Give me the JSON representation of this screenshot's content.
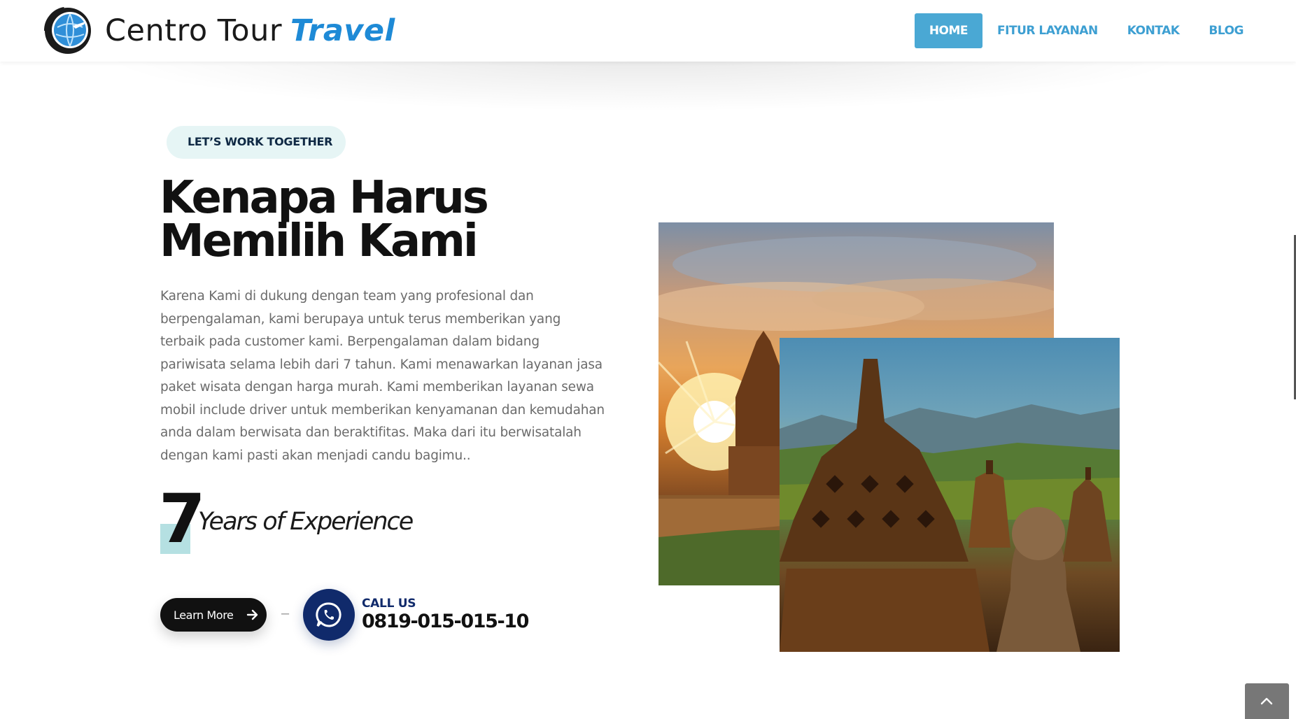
{
  "header": {
    "logo_text_primary": "Centro Tour",
    "logo_text_accent": "Travel",
    "nav": [
      {
        "label": "HOME",
        "active": true
      },
      {
        "label": "FITUR LAYANAN",
        "active": false
      },
      {
        "label": "KONTAK",
        "active": false
      },
      {
        "label": "BLOG",
        "active": false
      }
    ]
  },
  "section": {
    "tag": "LET’S WORK TOGETHER",
    "title": "Kenapa Harus Memilih Kami",
    "description": "Karena Kami di dukung dengan team yang profesional dan berpengalaman, kami berupaya untuk terus memberikan yang terbaik pada customer kami. Berpengalaman dalam bidang pariwisata selama lebih dari 7 tahun. Kami menawarkan layanan jasa paket wisata dengan harga murah. Kami memberikan layanan sewa mobil include driver untuk memberikan kenyamanan dan kemudahan anda dalam berwisata dan beraktifitas. Maka dari itu berwisatalah dengan kami pasti akan menjadi candu bagimu..",
    "experience_number": "7",
    "experience_text": "Years of Experience",
    "learn_more_label": "Learn More",
    "separator": "–",
    "call_label": "CALL US",
    "call_number": "0819-015-015-10"
  },
  "icons": {
    "logo": "globe-airplane-icon",
    "arrow": "arrow-right-icon",
    "whatsapp": "whatsapp-icon",
    "back_to_top": "chevron-up-icon"
  },
  "colors": {
    "nav_active_bg": "#4aa8d4",
    "nav_text": "#3d9fd2",
    "tag_bg": "#e6f5f5",
    "accent_navy": "#102a6b",
    "highlight": "#b5e0e2",
    "brand_blue": "#1e8ad6"
  }
}
